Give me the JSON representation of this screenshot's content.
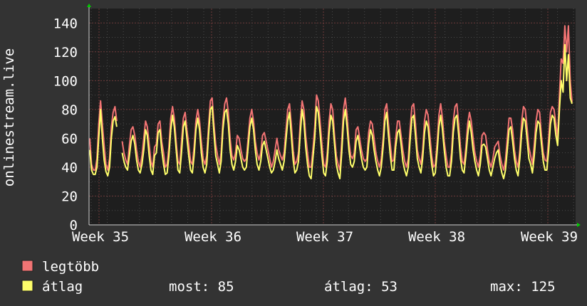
{
  "chart_data": {
    "type": "line",
    "ylabel": "onlinestream.live",
    "ylim": [
      0,
      150
    ],
    "yticks": [
      "0",
      "20",
      "40",
      "60",
      "80",
      "100",
      "120",
      "140"
    ],
    "x_labels": [
      "Week 35",
      "Week 36",
      "Week 37",
      "Week 38",
      "Week 39"
    ],
    "background": "#1e1e1e",
    "grid": true,
    "series": [
      {
        "name": "legtöbb",
        "color": "#f27474",
        "values": [
          60,
          42,
          38,
          38,
          46,
          70,
          86,
          70,
          55,
          42,
          38,
          46,
          68,
          78,
          82,
          72,
          null,
          null,
          58,
          50,
          45,
          42,
          55,
          66,
          68,
          62,
          52,
          44,
          40,
          48,
          60,
          72,
          68,
          56,
          44,
          40,
          54,
          56,
          70,
          72,
          58,
          50,
          40,
          42,
          54,
          74,
          82,
          74,
          58,
          44,
          42,
          58,
          74,
          78,
          66,
          56,
          44,
          42,
          54,
          72,
          80,
          72,
          58,
          46,
          42,
          48,
          68,
          86,
          88,
          70,
          56,
          48,
          42,
          50,
          72,
          84,
          88,
          78,
          60,
          48,
          45,
          50,
          62,
          60,
          52,
          46,
          44,
          46,
          60,
          74,
          80,
          72,
          58,
          50,
          45,
          50,
          62,
          64,
          58,
          52,
          46,
          40,
          44,
          52,
          60,
          52,
          48,
          45,
          50,
          65,
          80,
          84,
          70,
          52,
          42,
          44,
          50,
          72,
          86,
          80,
          62,
          50,
          40,
          40,
          52,
          68,
          90,
          86,
          72,
          56,
          42,
          40,
          50,
          72,
          84,
          80,
          62,
          48,
          42,
          38,
          58,
          80,
          88,
          76,
          58,
          48,
          46,
          50,
          66,
          68,
          60,
          52,
          46,
          44,
          46,
          64,
          72,
          70,
          60,
          50,
          44,
          40,
          46,
          60,
          80,
          84,
          70,
          56,
          44,
          45,
          60,
          72,
          72,
          62,
          52,
          44,
          40,
          46,
          66,
          82,
          84,
          70,
          52,
          46,
          42,
          52,
          72,
          80,
          76,
          62,
          48,
          40,
          42,
          56,
          76,
          84,
          74,
          58,
          48,
          40,
          40,
          50,
          72,
          82,
          84,
          70,
          54,
          44,
          42,
          54,
          70,
          78,
          72,
          60,
          50,
          44,
          40,
          48,
          62,
          64,
          62,
          52,
          44,
          40,
          46,
          54,
          56,
          58,
          48,
          42,
          38,
          45,
          60,
          74,
          74,
          66,
          52,
          44,
          40,
          52,
          72,
          82,
          80,
          68,
          54,
          48,
          42,
          56,
          72,
          80,
          78,
          62,
          50,
          45,
          44,
          60,
          78,
          82,
          80,
          70,
          60,
          90,
          115,
          112,
          138,
          120,
          138,
          100,
          85
        ]
      },
      {
        "name": "átlag",
        "color": "#ffff6a",
        "values": [
          52,
          38,
          35,
          35,
          40,
          60,
          80,
          60,
          45,
          37,
          34,
          40,
          60,
          72,
          75,
          68,
          null,
          null,
          50,
          44,
          40,
          38,
          48,
          58,
          62,
          56,
          45,
          38,
          36,
          42,
          52,
          66,
          62,
          48,
          38,
          35,
          48,
          50,
          64,
          66,
          52,
          42,
          35,
          36,
          48,
          66,
          76,
          68,
          52,
          38,
          36,
          50,
          68,
          72,
          60,
          48,
          38,
          36,
          48,
          66,
          74,
          66,
          50,
          40,
          36,
          42,
          62,
          80,
          82,
          64,
          48,
          42,
          36,
          44,
          66,
          78,
          80,
          70,
          52,
          42,
          38,
          44,
          55,
          52,
          46,
          40,
          38,
          40,
          54,
          68,
          74,
          66,
          52,
          42,
          38,
          44,
          55,
          58,
          52,
          46,
          40,
          36,
          38,
          44,
          52,
          46,
          42,
          38,
          44,
          58,
          72,
          78,
          62,
          45,
          36,
          38,
          44,
          64,
          80,
          72,
          54,
          42,
          34,
          32,
          46,
          60,
          82,
          78,
          64,
          48,
          36,
          34,
          44,
          64,
          76,
          72,
          56,
          42,
          36,
          32,
          50,
          72,
          80,
          68,
          52,
          42,
          40,
          44,
          58,
          62,
          54,
          46,
          40,
          38,
          40,
          56,
          66,
          62,
          52,
          44,
          38,
          34,
          40,
          54,
          72,
          78,
          62,
          48,
          38,
          38,
          54,
          64,
          66,
          56,
          44,
          38,
          34,
          40,
          58,
          74,
          76,
          62,
          46,
          40,
          36,
          46,
          64,
          72,
          68,
          54,
          42,
          34,
          36,
          50,
          68,
          76,
          66,
          52,
          40,
          34,
          34,
          44,
          64,
          74,
          76,
          62,
          46,
          38,
          36,
          48,
          62,
          72,
          64,
          52,
          44,
          38,
          34,
          42,
          55,
          56,
          54,
          46,
          38,
          34,
          40,
          46,
          50,
          52,
          42,
          36,
          32,
          38,
          52,
          66,
          68,
          58,
          46,
          38,
          34,
          46,
          64,
          74,
          72,
          60,
          46,
          42,
          36,
          48,
          64,
          72,
          70,
          56,
          44,
          38,
          38,
          52,
          70,
          76,
          74,
          62,
          55,
          80,
          100,
          92,
          125,
          100,
          118,
          88,
          84
        ]
      }
    ]
  },
  "legend": {
    "max_label": "legtöbb",
    "avg_label": "átlag",
    "now_text": "most: 85",
    "avg_text": "átlag: 53",
    "max_text": "max: 125",
    "max_color": "#f27474",
    "avg_color": "#ffff6a"
  }
}
